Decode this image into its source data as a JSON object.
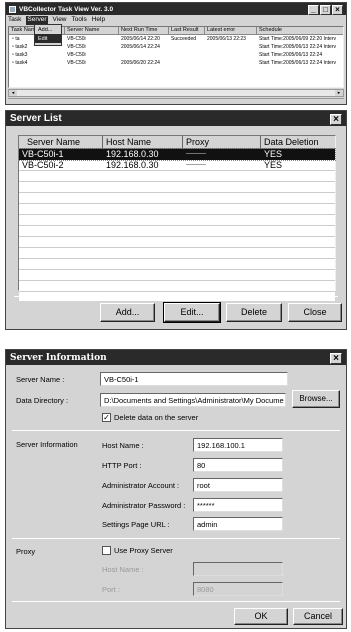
{
  "taskview": {
    "title": "VBCollector Task View Ver. 3.0",
    "menu": [
      "Task",
      "Server",
      "View",
      "Tools",
      "Help"
    ],
    "dropdown": [
      "Add...",
      "Edit"
    ],
    "columns": [
      "Task Name",
      "Server Name",
      "Next Run Time",
      "Last Result",
      "Latest error",
      "Schedule"
    ],
    "rows": [
      {
        "task": "ta",
        "server": "VB-C50i",
        "next": "2005/06/14 22:20",
        "result": "Succeeded",
        "error": "2005/06/13 22:23",
        "schedule": "Start Time:2005/06/09 22:20 Interv"
      },
      {
        "task": "task2",
        "server": "VB-C50i",
        "next": "2005/06/14 22:24",
        "result": "",
        "error": "",
        "schedule": "Start Time:2005/06/13 22:24 Interv"
      },
      {
        "task": "task3",
        "server": "VB-C50i",
        "next": "",
        "result": "",
        "error": "",
        "schedule": "Start Time:2005/06/13 22:24"
      },
      {
        "task": "task4",
        "server": "VB-C50i",
        "next": "2005/06/20 22:24",
        "result": "",
        "error": "",
        "schedule": "Start Time:2005/06/13 22:24 Interv"
      }
    ]
  },
  "serverlist": {
    "title": "Server List",
    "columns": [
      "Server Name",
      "Host Name",
      "Proxy",
      "Data Deletion"
    ],
    "rows": [
      {
        "name": "VB-C50i-1",
        "host": "192.168.0.30",
        "proxy": "----------",
        "deletion": "YES"
      },
      {
        "name": "VB-C50i-2",
        "host": "192.168.0.30",
        "proxy": "----------",
        "deletion": "YES"
      }
    ],
    "buttons": {
      "add": "Add...",
      "edit": "Edit...",
      "delete": "Delete",
      "close": "Close"
    }
  },
  "serverinfo": {
    "title": "Server Information",
    "server_name_label": "Server Name :",
    "server_name": "VB-C50i-1",
    "data_dir_label": "Data Directory :",
    "data_dir": "D:\\Documents and Settings\\Administrator\\My Docume",
    "browse": "Browse...",
    "delete_data_label": "Delete data on the server",
    "section_server": "Server Information",
    "host_label": "Host Name :",
    "host": "192.168.100.1",
    "http_label": "HTTP Port :",
    "http": "80",
    "admin_acct_label": "Administrator Account :",
    "admin_acct": "root",
    "admin_pw_label": "Administrator Password :",
    "admin_pw": "******",
    "settings_url_label": "Settings Page URL :",
    "settings_url": "admin",
    "section_proxy": "Proxy",
    "use_proxy_label": "Use Proxy Server",
    "proxy_host_label": "Host Name :",
    "proxy_host": "",
    "proxy_port_label": "Port :",
    "proxy_port": "8080",
    "ok": "OK",
    "cancel": "Cancel"
  }
}
